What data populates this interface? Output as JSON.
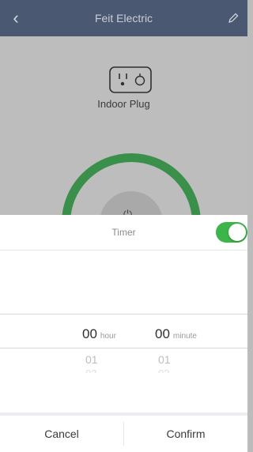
{
  "header": {
    "title": "Feit Electric",
    "back_icon": "chevron-left-icon",
    "edit_icon": "pencil-icon",
    "background": "#4a5872"
  },
  "device": {
    "label": "Indoor Plug",
    "icon": "outlet-icon",
    "ring_color": "#3a8f4a",
    "power_icon": "power-icon"
  },
  "timer": {
    "label": "Timer",
    "enabled": true,
    "toggle_color": "#3cb54a"
  },
  "picker": {
    "hour": {
      "selected": "00",
      "unit": "hour",
      "next": [
        "01",
        "02"
      ]
    },
    "minute": {
      "selected": "00",
      "unit": "minute",
      "next": [
        "01",
        "02"
      ]
    }
  },
  "actions": {
    "cancel_label": "Cancel",
    "confirm_label": "Confirm"
  }
}
